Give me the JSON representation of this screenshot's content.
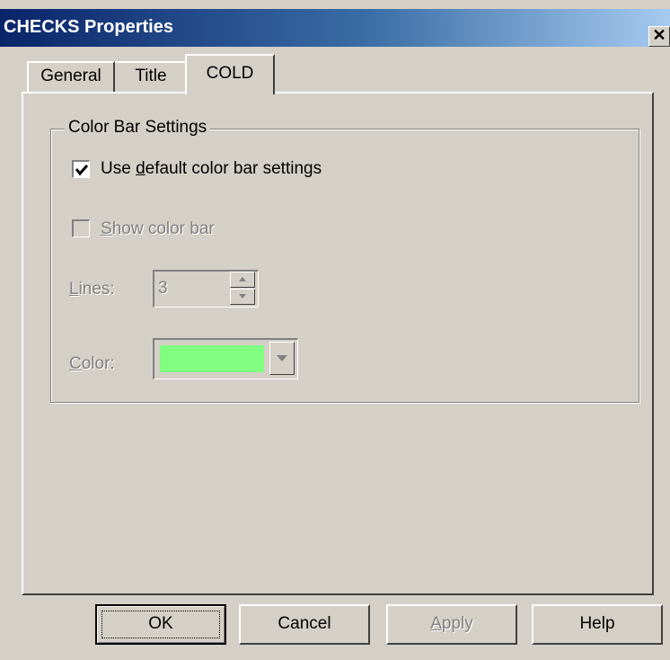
{
  "window": {
    "title": "CHECKS Properties",
    "close_glyph": "✕"
  },
  "tabs": [
    {
      "label": "General",
      "selected": false
    },
    {
      "label": "Title",
      "selected": false
    },
    {
      "label": "COLD",
      "selected": true
    }
  ],
  "group": {
    "label": "Color Bar Settings",
    "use_default": {
      "pre": "Use ",
      "accel": "d",
      "post": "efault color bar settings",
      "checked": true,
      "enabled": true
    },
    "show_color_bar": {
      "accel": "S",
      "post": "how color bar",
      "checked": false,
      "enabled": false
    },
    "lines": {
      "accel": "L",
      "post": "ines:",
      "value": "3",
      "enabled": false
    },
    "color": {
      "accel": "C",
      "post": "olor:",
      "value_hex": "#80ff80",
      "enabled": false
    }
  },
  "buttons": {
    "ok": "OK",
    "cancel": "Cancel",
    "apply": {
      "accel": "A",
      "post": "pply",
      "enabled": false
    },
    "help": "Help"
  },
  "colors": {
    "face": "#d4d0c8",
    "title_start": "#0a246a",
    "title_end": "#a6caf0",
    "disabled_text": "#808080"
  }
}
